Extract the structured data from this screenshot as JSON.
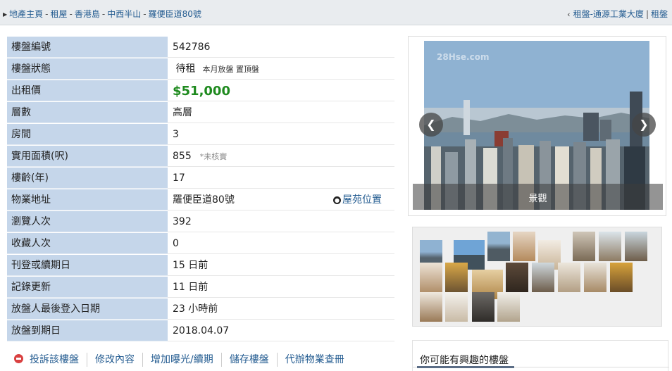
{
  "breadcrumb": {
    "items": [
      "地產主頁",
      "租屋",
      "香港島",
      "中西半山",
      "羅便臣道80號"
    ]
  },
  "next_link": {
    "prefix": "租盤-",
    "label": "通源工業大廈",
    "extra": "租盤"
  },
  "info_rows": [
    {
      "label": "樓盤編號",
      "value": "542786"
    },
    {
      "label": "樓盤狀態",
      "value": "待租",
      "extra": "本月放盤 置頂盤"
    },
    {
      "label": "出租價",
      "value": "$51,000"
    },
    {
      "label": "層數",
      "value": "高層"
    },
    {
      "label": "房間",
      "value": "3"
    },
    {
      "label": "實用面積(呎)",
      "value": "855",
      "note": "*未核實"
    },
    {
      "label": "樓齡(年)",
      "value": "17"
    },
    {
      "label": "物業地址",
      "value": "羅便臣道80號",
      "link": "屋苑位置"
    },
    {
      "label": "瀏覽人次",
      "value": "392"
    },
    {
      "label": "收藏人次",
      "value": "0"
    },
    {
      "label": "刊登或續期日",
      "value": "15 日前"
    },
    {
      "label": "記錄更新",
      "value": "11 日前"
    },
    {
      "label": "放盤人最後登入日期",
      "value": "23 小時前"
    },
    {
      "label": "放盤到期日",
      "value": "2018.04.07"
    }
  ],
  "actions": [
    "投訴該樓盤",
    "修改內容",
    "增加曝光/續期",
    "儲存樓盤",
    "代辦物業查冊"
  ],
  "photo": {
    "watermark": "28Hse.com",
    "caption": "景觀"
  },
  "colors": {
    "price": "#1e8a1e",
    "link": "#245c91",
    "label_bg": "#c5d6ea"
  },
  "related": {
    "title": "你可能有興趣的樓盤"
  }
}
